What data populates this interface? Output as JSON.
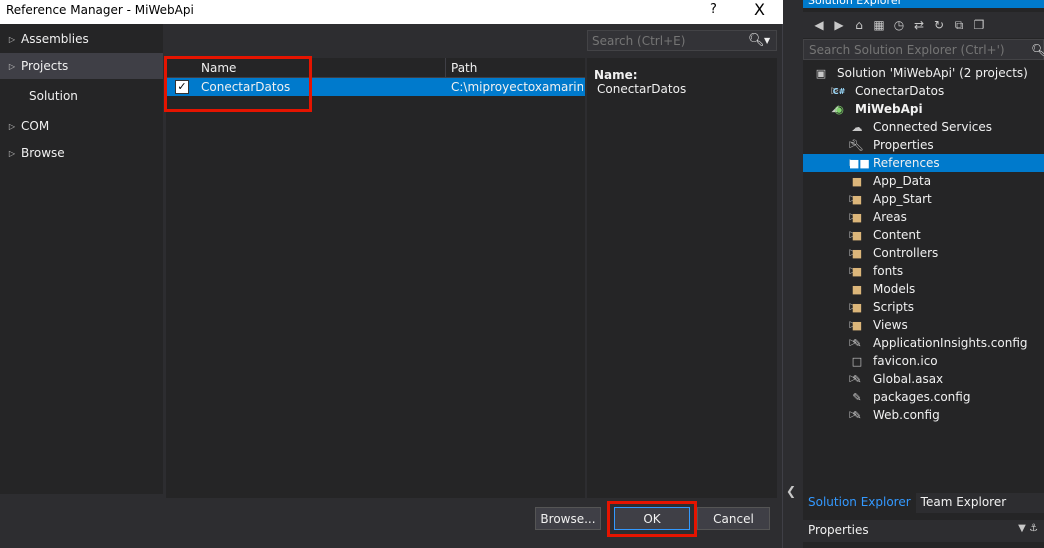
{
  "dialog": {
    "title": "Reference Manager - MiWebApi",
    "help_glyph": "?",
    "close_glyph": "X",
    "nav": [
      {
        "label": "Assemblies",
        "expandable": true,
        "active": false
      },
      {
        "label": "Projects",
        "expandable": true,
        "active": true
      },
      {
        "label": "Solution",
        "expandable": false,
        "active": false
      },
      {
        "label": "COM",
        "expandable": true,
        "active": false
      },
      {
        "label": "Browse",
        "expandable": true,
        "active": false
      }
    ],
    "search": {
      "placeholder": "Search (Ctrl+E)"
    },
    "grid": {
      "columns": [
        "Name",
        "Path"
      ],
      "rows": [
        {
          "name": "ConectarDatos",
          "path": "C:\\miproyectoxamarin...",
          "checked": true
        }
      ]
    },
    "details": {
      "label": "Name:",
      "value": "ConectarDatos"
    },
    "buttons": {
      "browse": "Browse...",
      "ok": "OK",
      "cancel": "Cancel"
    }
  },
  "solution_explorer": {
    "title": "Solution Explorer",
    "search_placeholder": "Search Solution Explorer (Ctrl+')",
    "tree": [
      {
        "label": "Solution 'MiWebApi' (2 projects)",
        "icon": "solution-icon",
        "arrow": "",
        "indent": 0,
        "bold": false,
        "selected": false
      },
      {
        "label": "ConectarDatos",
        "icon": "csharp-project-icon",
        "arrow": "collapsed",
        "indent": 1,
        "bold": false,
        "selected": false
      },
      {
        "label": "MiWebApi",
        "icon": "web-project-icon",
        "arrow": "expanded",
        "indent": 1,
        "bold": true,
        "selected": false
      },
      {
        "label": "Connected Services",
        "icon": "connected-services-icon",
        "arrow": "",
        "indent": 2,
        "bold": false,
        "selected": false
      },
      {
        "label": "Properties",
        "icon": "wrench-icon",
        "arrow": "collapsed",
        "indent": 2,
        "bold": false,
        "selected": false
      },
      {
        "label": "References",
        "icon": "references-icon",
        "arrow": "collapsed",
        "indent": 2,
        "bold": false,
        "selected": true
      },
      {
        "label": "App_Data",
        "icon": "folder-icon",
        "arrow": "",
        "indent": 2,
        "bold": false,
        "selected": false
      },
      {
        "label": "App_Start",
        "icon": "folder-icon",
        "arrow": "collapsed",
        "indent": 2,
        "bold": false,
        "selected": false
      },
      {
        "label": "Areas",
        "icon": "folder-icon",
        "arrow": "collapsed",
        "indent": 2,
        "bold": false,
        "selected": false
      },
      {
        "label": "Content",
        "icon": "folder-icon",
        "arrow": "collapsed",
        "indent": 2,
        "bold": false,
        "selected": false
      },
      {
        "label": "Controllers",
        "icon": "folder-icon",
        "arrow": "collapsed",
        "indent": 2,
        "bold": false,
        "selected": false
      },
      {
        "label": "fonts",
        "icon": "folder-icon",
        "arrow": "collapsed",
        "indent": 2,
        "bold": false,
        "selected": false
      },
      {
        "label": "Models",
        "icon": "folder-icon",
        "arrow": "",
        "indent": 2,
        "bold": false,
        "selected": false
      },
      {
        "label": "Scripts",
        "icon": "folder-icon",
        "arrow": "collapsed",
        "indent": 2,
        "bold": false,
        "selected": false
      },
      {
        "label": "Views",
        "icon": "folder-icon",
        "arrow": "collapsed",
        "indent": 2,
        "bold": false,
        "selected": false
      },
      {
        "label": "ApplicationInsights.config",
        "icon": "config-file-icon",
        "arrow": "collapsed",
        "indent": 2,
        "bold": false,
        "selected": false
      },
      {
        "label": "favicon.ico",
        "icon": "ico-file-icon",
        "arrow": "",
        "indent": 2,
        "bold": false,
        "selected": false
      },
      {
        "label": "Global.asax",
        "icon": "asax-file-icon",
        "arrow": "collapsed",
        "indent": 2,
        "bold": false,
        "selected": false
      },
      {
        "label": "packages.config",
        "icon": "config-file-icon",
        "arrow": "",
        "indent": 2,
        "bold": false,
        "selected": false
      },
      {
        "label": "Web.config",
        "icon": "config-file-icon",
        "arrow": "collapsed",
        "indent": 2,
        "bold": false,
        "selected": false
      }
    ],
    "tabs": [
      {
        "label": "Solution Explorer",
        "active": true
      },
      {
        "label": "Team Explorer",
        "active": false
      }
    ],
    "properties_title": "Properties"
  },
  "colors": {
    "accent": "#007acc",
    "highlight_box": "#e51400",
    "folder": "#dcb67a"
  }
}
